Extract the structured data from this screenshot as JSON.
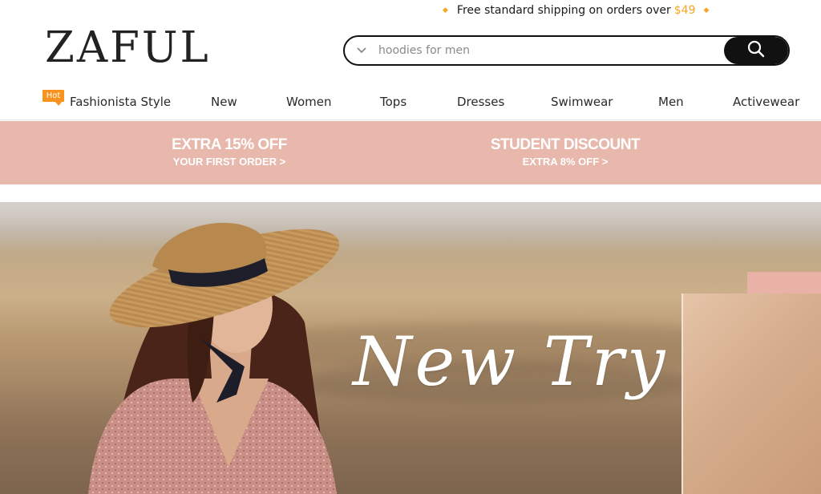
{
  "shipping": {
    "text": "Free standard shipping on orders over",
    "price": "$49"
  },
  "logo": "ZAFUL",
  "search": {
    "placeholder": "hoodies for men",
    "value": ""
  },
  "nav": {
    "hot_badge": "Hot",
    "items": [
      {
        "label": "Fashionista Style"
      },
      {
        "label": "New"
      },
      {
        "label": "Women"
      },
      {
        "label": "Tops"
      },
      {
        "label": "Dresses"
      },
      {
        "label": "Swimwear"
      },
      {
        "label": "Men"
      },
      {
        "label": "Activewear"
      }
    ]
  },
  "promo": {
    "left": {
      "title": "EXTRA 15% OFF",
      "sub": "YOUR FIRST ORDER >"
    },
    "right": {
      "title": "STUDENT DISCOUNT",
      "sub": "EXTRA 8% OFF >"
    }
  },
  "hero": {
    "tagline": "New Try"
  },
  "colors": {
    "accent": "#f5a623",
    "promo_bg": "#e8b8ac",
    "hot_badge": "#f7931e"
  }
}
